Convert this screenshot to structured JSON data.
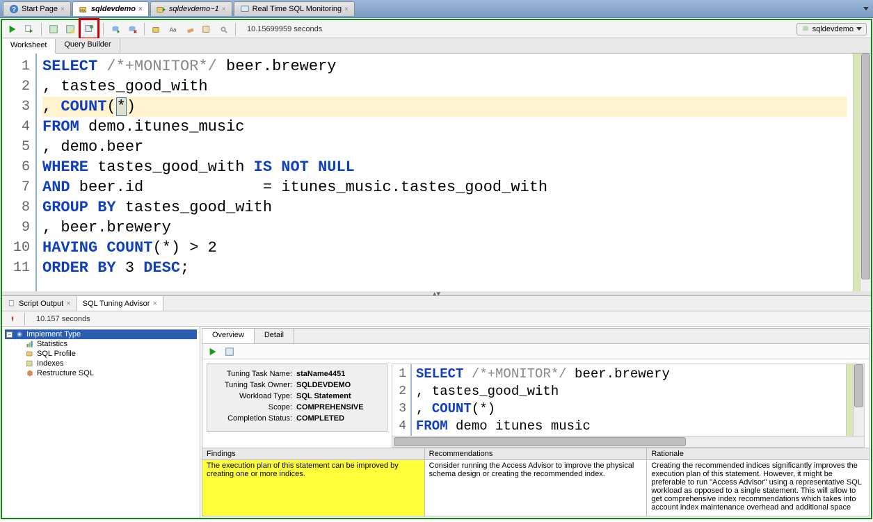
{
  "top_tabs": [
    {
      "label": "Start Page",
      "icon": "help-icon",
      "closable": true,
      "active": false
    },
    {
      "label": "sqldevdemo",
      "icon": "db-icon",
      "closable": true,
      "active": true,
      "italic": true
    },
    {
      "label": "sqldevdemo~1",
      "icon": "db-run-icon",
      "closable": true,
      "active": false,
      "italic": true
    },
    {
      "label": "Real Time SQL Monitoring",
      "icon": "monitor-icon",
      "closable": true,
      "active": false
    }
  ],
  "toolbar_status": "10.15699959 seconds",
  "connection": "sqldevdemo",
  "sub_tabs": [
    {
      "label": "Worksheet",
      "active": true
    },
    {
      "label": "Query Builder",
      "active": false
    }
  ],
  "editor": {
    "highlight_line_index": 2,
    "lines": [
      [
        {
          "t": "SELECT",
          "c": "kw"
        },
        {
          "t": " ",
          "c": ""
        },
        {
          "t": "/*+MONITOR*/",
          "c": "cmt"
        },
        {
          "t": " beer.brewery",
          "c": ""
        }
      ],
      [
        {
          "t": ", tastes_good_with",
          "c": ""
        }
      ],
      [
        {
          "t": ", ",
          "c": ""
        },
        {
          "t": "COUNT",
          "c": "kw"
        },
        {
          "t": "(",
          "c": ""
        },
        {
          "t": "*",
          "c": "cursor"
        },
        {
          "t": ")",
          "c": ""
        }
      ],
      [
        {
          "t": "FROM",
          "c": "kw"
        },
        {
          "t": " demo.itunes_music",
          "c": ""
        }
      ],
      [
        {
          "t": ", demo.beer",
          "c": ""
        }
      ],
      [
        {
          "t": "WHERE",
          "c": "kw"
        },
        {
          "t": " tastes_good_with ",
          "c": ""
        },
        {
          "t": "IS NOT NULL",
          "c": "kw"
        }
      ],
      [
        {
          "t": "AND",
          "c": "kw"
        },
        {
          "t": " beer.id             = itunes_music.tastes_good_with",
          "c": ""
        }
      ],
      [
        {
          "t": "GROUP BY",
          "c": "kw"
        },
        {
          "t": " tastes_good_with",
          "c": ""
        }
      ],
      [
        {
          "t": ", beer.brewery",
          "c": ""
        }
      ],
      [
        {
          "t": "HAVING",
          "c": "kw"
        },
        {
          "t": " ",
          "c": ""
        },
        {
          "t": "COUNT",
          "c": "kw"
        },
        {
          "t": "(*) > 2",
          "c": ""
        }
      ],
      [
        {
          "t": "ORDER BY",
          "c": "kw"
        },
        {
          "t": " 3 ",
          "c": ""
        },
        {
          "t": "DESC",
          "c": "kw"
        },
        {
          "t": ";",
          "c": ""
        }
      ]
    ]
  },
  "output_tabs": [
    {
      "label": "Script Output",
      "closable": true,
      "active": false,
      "icon": "script-icon"
    },
    {
      "label": "SQL Tuning Advisor",
      "closable": true,
      "active": true
    }
  ],
  "output_status": "10.157 seconds",
  "advisor_tree": {
    "root": {
      "label": "Implement Type",
      "icon": "gear-icon",
      "selected": true
    },
    "children": [
      {
        "label": "Statistics",
        "icon": "stats-icon"
      },
      {
        "label": "SQL Profile",
        "icon": "profile-icon"
      },
      {
        "label": "Indexes",
        "icon": "index-icon"
      },
      {
        "label": "Restructure SQL",
        "icon": "restructure-icon"
      }
    ]
  },
  "advisor_subtabs": [
    {
      "label": "Overview",
      "active": true
    },
    {
      "label": "Detail",
      "active": false
    }
  ],
  "advisor_meta": [
    {
      "label": "Tuning Task Name:",
      "value": "staName4451"
    },
    {
      "label": "Tuning Task Owner:",
      "value": "SQLDEVDEMO"
    },
    {
      "label": "Workload Type:",
      "value": "SQL Statement"
    },
    {
      "label": "Scope:",
      "value": "COMPREHENSIVE"
    },
    {
      "label": "Completion Status:",
      "value": "COMPLETED"
    }
  ],
  "advisor_code_lines": [
    [
      {
        "t": "SELECT",
        "c": "kw"
      },
      {
        "t": " ",
        "c": ""
      },
      {
        "t": "/*+MONITOR*/",
        "c": "cmt"
      },
      {
        "t": " beer.brewery",
        "c": ""
      }
    ],
    [
      {
        "t": ", tastes_good_with",
        "c": ""
      }
    ],
    [
      {
        "t": ", ",
        "c": ""
      },
      {
        "t": "COUNT",
        "c": "kw"
      },
      {
        "t": "(*)",
        "c": ""
      }
    ],
    [
      {
        "t": "FROM",
        "c": "kw"
      },
      {
        "t": " demo itunes music",
        "c": ""
      }
    ]
  ],
  "findings": {
    "columns": [
      "Findings",
      "Recommendations",
      "Rationale"
    ],
    "row": [
      "The execution plan of this statement can be improved by creating one or more indices.",
      "Consider running the Access Advisor to improve the physical schema design or creating the recommended index.",
      "Creating the recommended indices significantly improves the execution plan of this statement. However, it might be preferable to run \"Access Advisor\" using a representative SQL workload as opposed to a single statement. This will allow to get comprehensive index recommendations which takes into account index maintenance overhead and additional space"
    ]
  }
}
